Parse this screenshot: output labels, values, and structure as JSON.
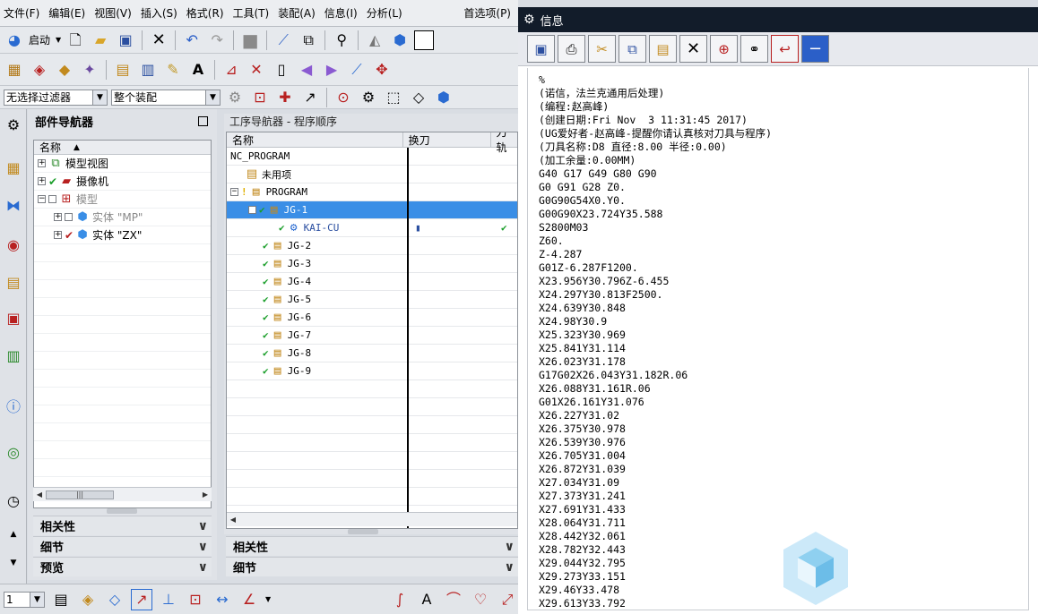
{
  "menubar": {
    "items": [
      "文件(F)",
      "编辑(E)",
      "视图(V)",
      "插入(S)",
      "格式(R)",
      "工具(T)",
      "装配(A)",
      "信息(I)",
      "分析(L)",
      "首选项(P)"
    ]
  },
  "toolbar": {
    "start_label": "启动",
    "filter_value": "无选择过滤器",
    "assembly_value": "整个装配"
  },
  "part_navigator": {
    "title": "部件导航器",
    "column_name": "名称",
    "nodes": [
      {
        "label": "模型视图"
      },
      {
        "label": "摄像机"
      },
      {
        "label": "模型"
      },
      {
        "label": "实体 \"MP\""
      },
      {
        "label": "实体 \"ZX\""
      }
    ],
    "accordion": [
      "相关性",
      "细节",
      "预览"
    ]
  },
  "op_navigator": {
    "title": "工序导航器 - 程序顺序",
    "columns": [
      "名称",
      "换刀",
      "刀轨"
    ],
    "rows": [
      "NC_PROGRAM",
      "未用项",
      "PROGRAM",
      "JG-1",
      "KAI-CU",
      "JG-2",
      "JG-3",
      "JG-4",
      "JG-5",
      "JG-6",
      "JG-7",
      "JG-8",
      "JG-9"
    ],
    "accordion": [
      "相关性",
      "细节"
    ]
  },
  "bottom_toolbar": {
    "layer_value": "1"
  },
  "info_window": {
    "title": "信息",
    "lines": [
      "%",
      "(诺信，法兰克通用后处理)",
      "(编程:赵高峰)",
      "(创建日期:Fri Nov  3 11:31:45 2017)",
      "(UG爱好者-赵高峰-提醒你请认真核对刀具与程序)",
      "(刀具名称:D8 直径:8.00 半径:0.00)",
      "(加工余量:0.00MM)",
      "G40 G17 G49 G80 G90",
      "G0 G91 G28 Z0.",
      "G0G90G54X0.Y0.",
      "G00G90X23.724Y35.588",
      "S2800M03",
      "Z60.",
      "Z-4.287",
      "G01Z-6.287F1200.",
      "X23.956Y30.796Z-6.455",
      "X24.297Y30.813F2500.",
      "X24.639Y30.848",
      "X24.98Y30.9",
      "X25.323Y30.969",
      "X25.841Y31.114",
      "X26.023Y31.178",
      "G17G02X26.043Y31.182R.06",
      "X26.088Y31.161R.06",
      "G01X26.161Y31.076",
      "X26.227Y31.02",
      "X26.375Y30.978",
      "X26.539Y30.976",
      "X26.705Y31.004",
      "X26.872Y31.039",
      "X27.034Y31.09",
      "X27.373Y31.241",
      "X27.691Y31.433",
      "X28.064Y31.711",
      "X28.442Y32.061",
      "X28.782Y32.443",
      "X29.044Y32.795",
      "X29.273Y33.151",
      "X29.46Y33.478",
      "X29.613Y33.792"
    ]
  }
}
